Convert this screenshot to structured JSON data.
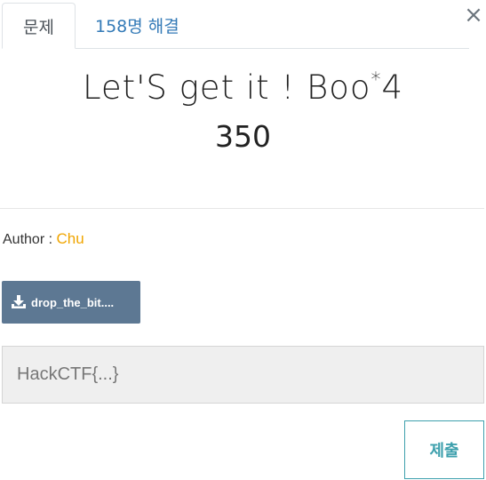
{
  "tabs": [
    {
      "label": "문제",
      "active": true
    },
    {
      "label": "158명 해결",
      "active": false
    }
  ],
  "close_glyph": "×",
  "challenge": {
    "title_main": "Let'S get it ! Boo",
    "title_sup": "*",
    "title_tail": "4",
    "points": "350"
  },
  "author": {
    "label": "Author : ",
    "name": "Chu",
    "name_color": "#f0a500"
  },
  "file": {
    "label": "drop_the_bit....",
    "icon": "download-icon"
  },
  "flag": {
    "placeholder": "HackCTF{...}",
    "value": ""
  },
  "submit": {
    "label": "제출",
    "color": "#3ea0ad"
  }
}
